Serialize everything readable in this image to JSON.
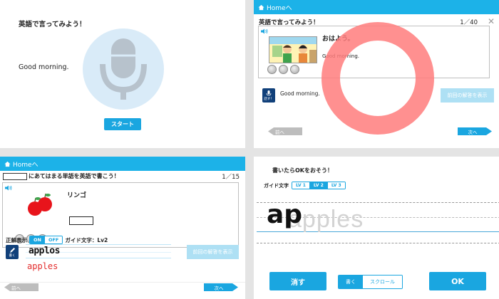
{
  "panel1": {
    "title": "英語で言ってみよう！",
    "phrase": "Good morning.",
    "start_label": "スタート"
  },
  "panel2": {
    "home_label": "Homeへ",
    "title": "英語で言ってみよう！",
    "progress": "1／40",
    "close_label": "✕",
    "jp_phrase": "おはよう。",
    "en_phrase": "Good morning.",
    "mic_badge_label": "話す！",
    "answer_text": "Good morning.",
    "prev_answer_label": "前回の解答を表示",
    "prev_label": "前へ",
    "next_label": "次へ"
  },
  "panel3": {
    "home_label": "Homeへ",
    "question": "にあてはまる単語を英語で書こう！",
    "progress": "1／15",
    "jp_word": "リンゴ",
    "correct_display_label": "正解表示",
    "toggle_on": "ON",
    "toggle_off": "OFF",
    "guide_label": "ガイド文字：Lv2",
    "pen_badge_label": "書く",
    "handwritten": "applos",
    "correct_answer": "apples",
    "prev_answer_label": "前回の解答を表示",
    "prev_label": "前へ",
    "next_label": "次へ"
  },
  "panel4": {
    "title": "書いたらOKをおそう！",
    "guide_label": "ガイド文字",
    "levels": [
      "LV 1",
      "LV 2",
      "LV 3"
    ],
    "selected_level": "LV 2",
    "guide_word": "apples",
    "handwritten_part": "ap",
    "clear_label": "消す",
    "mode_write": "書く",
    "mode_scroll": "スクロール",
    "ok_label": "OK"
  },
  "colors": {
    "accent": "#1aa6e0",
    "header": "#1cb2e8",
    "badge": "#11407a",
    "highlight_ring": "#ff7d7d",
    "answer_red": "#e32b2b"
  }
}
